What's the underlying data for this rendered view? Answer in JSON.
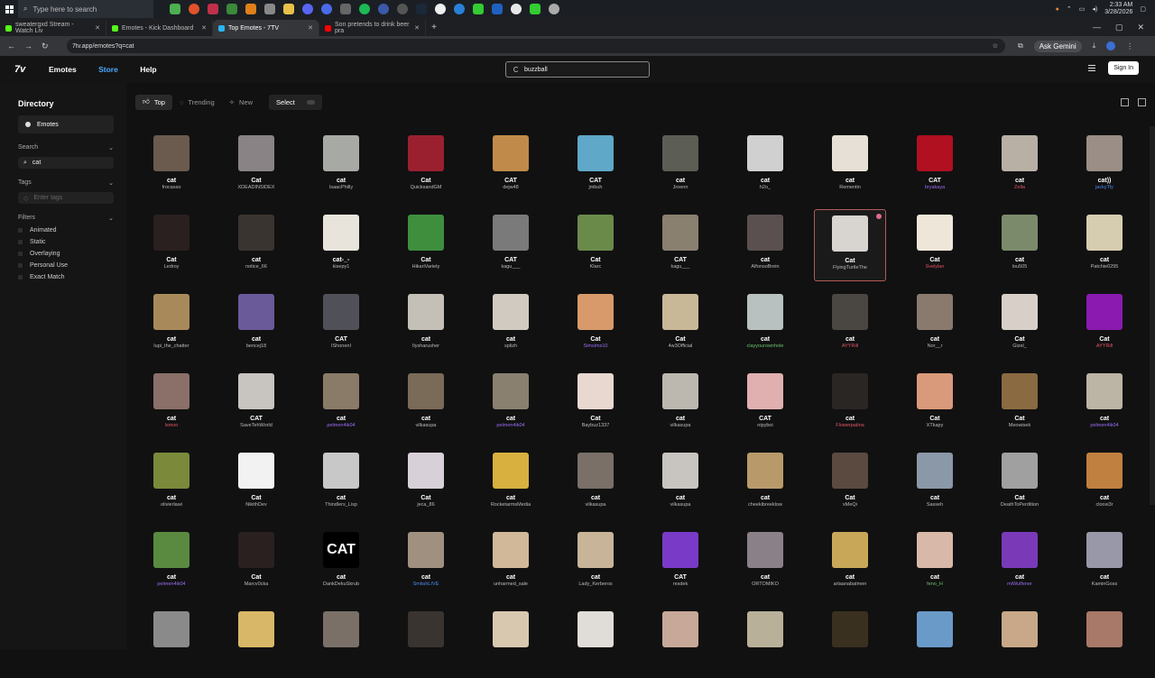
{
  "taskbar": {
    "search_placeholder": "Type here to search",
    "time": "2:33 AM",
    "date": "3/28/2026"
  },
  "tabs": [
    {
      "label": "sweatergxd Stream - Watch Liv",
      "color": "#53fc18"
    },
    {
      "label": "Emotes - Kick Dashboard",
      "color": "#53fc18"
    },
    {
      "label": "Top Emotes - 7TV",
      "color": "#29b6f6"
    },
    {
      "label": "Son pretends to drink beer pra",
      "color": "#ff0000"
    }
  ],
  "address": {
    "url": "7tv.app/emotes?q=cat",
    "gemini": "Ask Gemini"
  },
  "header": {
    "logo": "7v",
    "nav": [
      "Emotes",
      "Store",
      "Help"
    ],
    "search_value": "buzzball",
    "signin": "Sign In"
  },
  "sidebar": {
    "title": "Directory",
    "emotes_label": "Emotes",
    "search_label": "Search",
    "search_value": "cat",
    "tags_label": "Tags",
    "tags_placeholder": "Enter tags",
    "filters_label": "Filters",
    "filters": [
      "Animated",
      "Static",
      "Overlaying",
      "Personal Use",
      "Exact Match"
    ]
  },
  "toolbar": {
    "top": "Top",
    "trending": "Trending",
    "new": "New",
    "select": "Select"
  },
  "emotes": [
    {
      "name": "cat",
      "owner": "frocasso",
      "color": "#6b5a4e"
    },
    {
      "name": "Cat",
      "owner": "XDEADINSIDEX",
      "color": "#8a8385"
    },
    {
      "name": "cat",
      "owner": "IsaacPhilly",
      "color": "#a7a9a5"
    },
    {
      "name": "Cat",
      "owner": "QuicksandGM",
      "color": "#9a2030"
    },
    {
      "name": "CAT",
      "owner": "dejw48",
      "color": "#c08b4a"
    },
    {
      "name": "CAT",
      "owner": "jmbuh",
      "color": "#5fa8c8"
    },
    {
      "name": "cat",
      "owner": "Jroenn",
      "color": "#5c5d55"
    },
    {
      "name": "cat",
      "owner": "h2o_",
      "color": "#d0d0d0"
    },
    {
      "name": "cat",
      "owner": "Rementin",
      "color": "#e6e0d6"
    },
    {
      "name": "CAT",
      "owner": "bryakaya",
      "color": "#b01020",
      "ownerStyle": "p"
    },
    {
      "name": "cat",
      "owner": "Zella",
      "color": "#b8b0a5",
      "ownerStyle": "r"
    },
    {
      "name": "cat))",
      "owner": "jackyTly",
      "color": "#9a8e86",
      "ownerStyle": "b"
    },
    {
      "name": "Cat",
      "owner": "Ledroy",
      "color": "#2a2020"
    },
    {
      "name": "cat",
      "owner": "notice_66",
      "color": "#3a3430"
    },
    {
      "name": "cat-_-",
      "owner": "kisepy1",
      "color": "#e8e4dc"
    },
    {
      "name": "Cat",
      "owner": "HikariVariety",
      "color": "#3e8e3e"
    },
    {
      "name": "CAT",
      "owner": "kagu___",
      "color": "#7a7a7a"
    },
    {
      "name": "Cat",
      "owner": "Klarc",
      "color": "#6a8a4a"
    },
    {
      "name": "CAT",
      "owner": "kagu___",
      "color": "#8a8070"
    },
    {
      "name": "cat",
      "owner": "AlfonsoBrein",
      "color": "#5a5050"
    },
    {
      "name": "Cat",
      "owner": "FlyingTurtleThe",
      "color": "#d8d4d0",
      "hover": true
    },
    {
      "name": "Cat",
      "owner": "Svelylan",
      "color": "#efe6da",
      "ownerStyle": "r"
    },
    {
      "name": "cat",
      "owner": "lou505",
      "color": "#7c8a6c"
    },
    {
      "name": "cat",
      "owner": "Patchie0295",
      "color": "#d6ccb0"
    },
    {
      "name": "cat",
      "owner": "lupi_the_chatter",
      "color": "#a88a5a"
    },
    {
      "name": "cat",
      "owner": "bencej18",
      "color": "#6a5a9a"
    },
    {
      "name": "CAT",
      "owner": "IShonenI",
      "color": "#505058"
    },
    {
      "name": "cat",
      "owner": "Ilysharusher",
      "color": "#c4c0b8"
    },
    {
      "name": "cat",
      "owner": "splizh",
      "color": "#d0cac0"
    },
    {
      "name": "Cat",
      "owner": "Simsims10",
      "color": "#d89a6a",
      "ownerStyle": "p"
    },
    {
      "name": "Cat",
      "owner": "4w3Official",
      "color": "#c8b898"
    },
    {
      "name": "cat",
      "owner": "clayyourownhole",
      "color": "#b8c0c0",
      "ownerStyle": "g"
    },
    {
      "name": "cat",
      "owner": "AYYRill",
      "color": "#4a4642",
      "ownerStyle": "r"
    },
    {
      "name": "cat",
      "owner": "Nor__r",
      "color": "#8a7a6e"
    },
    {
      "name": "Cat",
      "owner": "Gizel_",
      "color": "#d8d0c8"
    },
    {
      "name": "Cat",
      "owner": "AYYRill",
      "color": "#8a1ab0",
      "ownerStyle": "r"
    },
    {
      "name": "cat",
      "owner": "lsmoo",
      "color": "#8a7068",
      "ownerStyle": "r"
    },
    {
      "name": "CAT",
      "owner": "SaveTehWorld",
      "color": "#c8c4c0"
    },
    {
      "name": "cat",
      "owner": "pelmen4ik04",
      "color": "#8a7a68",
      "ownerStyle": "p"
    },
    {
      "name": "cat",
      "owner": "vilkasupa",
      "color": "#7a6a58"
    },
    {
      "name": "cat",
      "owner": "pelmen4ik04",
      "color": "#8a8070",
      "ownerStyle": "p"
    },
    {
      "name": "Cat",
      "owner": "Baybuz1337",
      "color": "#e8d8d0"
    },
    {
      "name": "cat",
      "owner": "vilkasupa",
      "color": "#bcb8b0"
    },
    {
      "name": "CAT",
      "owner": "nipyboi",
      "color": "#e0b0b0"
    },
    {
      "name": "cat",
      "owner": "Flowerpatina",
      "color": "#2a2624",
      "ownerStyle": "r"
    },
    {
      "name": "Cat",
      "owner": "XTkapy",
      "color": "#d89a7a"
    },
    {
      "name": "Cat",
      "owner": "Meowisek",
      "color": "#8a6a40"
    },
    {
      "name": "cat",
      "owner": "pelmen4ik04",
      "color": "#bcb4a4",
      "ownerStyle": "p"
    },
    {
      "name": "cat",
      "owner": "olivierlawi",
      "color": "#7a8a3a"
    },
    {
      "name": "Cat",
      "owner": "NikithDev",
      "color": "#f2f2f2"
    },
    {
      "name": "cat",
      "owner": "Thindlers_Lisp",
      "color": "#c8c8c8"
    },
    {
      "name": "Cat",
      "owner": "jeca_86",
      "color": "#d8d0d8"
    },
    {
      "name": "cat",
      "owner": "RocketarmsMedia",
      "color": "#d8b040"
    },
    {
      "name": "cat",
      "owner": "vilkasupa",
      "color": "#7a7068"
    },
    {
      "name": "cat",
      "owner": "vilkasupa",
      "color": "#c8c4c0"
    },
    {
      "name": "cat",
      "owner": "cheekibreeklow",
      "color": "#b89a6a"
    },
    {
      "name": "Cat",
      "owner": "xMeQi",
      "color": "#5a4a40"
    },
    {
      "name": "cat",
      "owner": "Sasseh",
      "color": "#8a98a8"
    },
    {
      "name": "Cat",
      "owner": "DeathToPerdition",
      "color": "#a0a0a0"
    },
    {
      "name": "cat",
      "owner": "cloosi3r",
      "color": "#c08040"
    },
    {
      "name": "cat",
      "owner": "pelmen4ik04",
      "color": "#5a8a40",
      "ownerStyle": "p"
    },
    {
      "name": "Cat",
      "owner": "Marcv0cka",
      "color": "#2a2020"
    },
    {
      "name": "cat",
      "owner": "DankDekuSkrub",
      "color": "#000000",
      "text": "CAT"
    },
    {
      "name": "cat",
      "owner": "SmitshLIVE",
      "color": "#a09080",
      "ownerStyle": "b"
    },
    {
      "name": "cat",
      "owner": "unharmed_sale",
      "color": "#d0b898"
    },
    {
      "name": "cat",
      "owner": "Lady_Kerberos",
      "color": "#c8b498"
    },
    {
      "name": "CAT",
      "owner": "resdek",
      "color": "#7a3ac8"
    },
    {
      "name": "cat",
      "owner": "ORTOMIKO",
      "color": "#8a8088"
    },
    {
      "name": "cat",
      "owner": "arlaanabatmen",
      "color": "#c8a858"
    },
    {
      "name": "cat",
      "owner": "feno_H",
      "color": "#d8b8a8",
      "ownerStyle": "g"
    },
    {
      "name": "cat",
      "owner": "miWulfener",
      "color": "#7a3ab8",
      "ownerStyle": "p"
    },
    {
      "name": "cat",
      "owner": "KaminGoss",
      "color": "#9898a8"
    },
    {
      "name": "",
      "owner": "",
      "color": "#8a8a8a"
    },
    {
      "name": "",
      "owner": "",
      "color": "#d8b868"
    },
    {
      "name": "",
      "owner": "",
      "color": "#7a7068"
    },
    {
      "name": "",
      "owner": "",
      "color": "#3a3430"
    },
    {
      "name": "",
      "owner": "",
      "color": "#d8c8b0"
    },
    {
      "name": "",
      "owner": "",
      "color": "#e0dcd8"
    },
    {
      "name": "",
      "owner": "",
      "color": "#c8a898"
    },
    {
      "name": "",
      "owner": "",
      "color": "#b8b098"
    },
    {
      "name": "",
      "owner": "",
      "color": "#3a3020"
    },
    {
      "name": "",
      "owner": "",
      "color": "#6a9ac8"
    },
    {
      "name": "",
      "owner": "",
      "color": "#c8a888"
    },
    {
      "name": "",
      "owner": "",
      "color": "#a87868"
    }
  ]
}
